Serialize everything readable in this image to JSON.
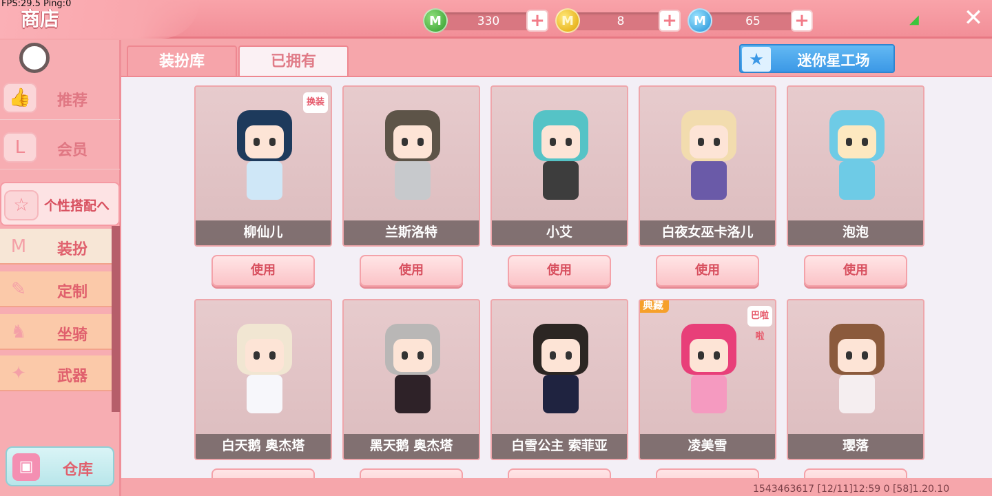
{
  "debug": "FPS:29.5  Ping:0",
  "header": {
    "title": "商店",
    "currencies": [
      {
        "icon": "green-gem-icon",
        "letter": "M",
        "value": "330"
      },
      {
        "icon": "gold-coin-icon",
        "letter": "M",
        "value": "8"
      },
      {
        "icon": "blue-coin-icon",
        "letter": "M",
        "value": "65"
      }
    ],
    "plus": "+",
    "close": "✕",
    "signal": "◢"
  },
  "sidebar": {
    "items": [
      {
        "label": "推荐",
        "icon": "👍"
      },
      {
        "label": "会员",
        "icon": "L"
      },
      {
        "label": "个性搭配へ",
        "icon": "☆"
      }
    ],
    "sub_items": [
      {
        "label": "装扮",
        "icon": "M"
      },
      {
        "label": "定制",
        "icon": "✎"
      },
      {
        "label": "坐骑",
        "icon": "♞"
      },
      {
        "label": "武器",
        "icon": "✦"
      }
    ],
    "warehouse": {
      "label": "仓库",
      "icon": "▣"
    }
  },
  "tabs": {
    "library": "装扮库",
    "owned": "已拥有"
  },
  "workshop": {
    "label": "迷你星工场",
    "icon": "★"
  },
  "cards": [
    {
      "name": "柳仙儿",
      "corner": "换装",
      "hair": "#1d3a5c",
      "outfit": "#cfe7f7",
      "skin": "#fde4d6"
    },
    {
      "name": "兰斯洛特",
      "hair": "#5d5448",
      "outfit": "#c7c9cc",
      "skin": "#fde4d6"
    },
    {
      "name": "小艾",
      "hair": "#55c3c6",
      "outfit": "#3d3d3d",
      "skin": "#fde4d6"
    },
    {
      "name": "白夜女巫卡洛儿",
      "hair": "#f2dcae",
      "outfit": "#6a5aa8",
      "skin": "#fde4d6"
    },
    {
      "name": "泡泡",
      "hair": "#6ecbe6",
      "outfit": "#6ecbe6",
      "skin": "#fde8c0"
    },
    {
      "name": "白天鹅 奥杰塔",
      "hair": "#f1e6d2",
      "outfit": "#f7f7fb",
      "skin": "#fde4d6"
    },
    {
      "name": "黑天鹅 奥杰塔",
      "hair": "#b9b7b6",
      "outfit": "#2e2228",
      "skin": "#fde4d6"
    },
    {
      "name": "白雪公主 索菲亚",
      "hair": "#2c2623",
      "outfit": "#1f2340",
      "skin": "#fde4d6"
    },
    {
      "name": "凌美雪",
      "tag": "典藏",
      "corner": "巴啦啦",
      "hair": "#e83f79",
      "outfit": "#f59ac0",
      "skin": "#fde4d6"
    },
    {
      "name": "瓔落",
      "hair": "#8b5a3c",
      "outfit": "#f5eef0",
      "skin": "#fde4d6"
    }
  ],
  "use_label": "使用",
  "footer": "1543463617  [12/11]12:59 0  [58]1.20.10"
}
